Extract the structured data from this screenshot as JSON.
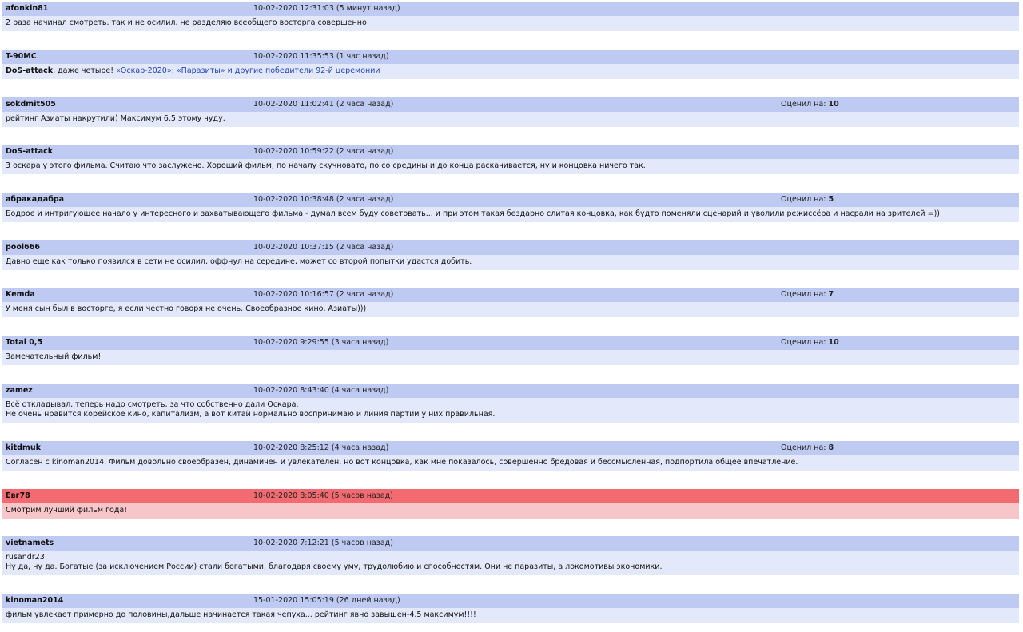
{
  "rating_label": "Оценил на:",
  "comments": [
    {
      "user": "afonkin81",
      "time": "10-02-2020 12:31:03 (5 минут назад)",
      "rating": "",
      "lines": [
        "2 раза начинал смотреть. так и не осилил. не разделяю всеобщего восторга совершенно"
      ]
    },
    {
      "user": "T-90MC",
      "time": "10-02-2020 11:35:53 (1 час назад)",
      "rating": "",
      "reply_to": "DoS-attack",
      "reply_text": ", даже четыре! ",
      "link": "«Оскар-2020»: «Паразиты» и другие победители 92-й церемонии"
    },
    {
      "user": "sokdmit505",
      "time": "10-02-2020 11:02:41 (2 часа назад)",
      "rating": "10",
      "lines": [
        "рейтинг Азиаты накрутили) Максимум 6.5 этому чуду."
      ]
    },
    {
      "user": "DoS-attack",
      "time": "10-02-2020 10:59:22 (2 часа назад)",
      "rating": "",
      "lines": [
        "3 оскара у этого фильма. Считаю что заслужено. Хороший фильм, по началу скучновато, по со средины и до конца раскачивается, ну и концовка ничего так."
      ]
    },
    {
      "user": "абракадабра",
      "time": "10-02-2020 10:38:48 (2 часа назад)",
      "rating": "5",
      "lines": [
        "Бодрое и интригующее начало у интересного и захватывающего фильма - думал всем буду советовать... и при этом такая бездарно слитая концовка, как будто поменяли сценарий и уволили режиссёра и насрали на зрителей =))"
      ]
    },
    {
      "user": "pool666",
      "time": "10-02-2020 10:37:15 (2 часа назад)",
      "rating": "",
      "lines": [
        "Давно еще как только появился в сети не осилил, оффнул на середине, может со второй попытки удастся добить."
      ]
    },
    {
      "user": "Kemda",
      "time": "10-02-2020 10:16:57 (2 часа назад)",
      "rating": "7",
      "lines": [
        "У меня сын был в восторге, я если честно говоря не очень. Своеобразное кино. Азиаты)))"
      ]
    },
    {
      "user": "Total 0,5",
      "time": "10-02-2020 9:29:55 (3 часа назад)",
      "rating": "10",
      "lines": [
        "Замечательный фильм!"
      ]
    },
    {
      "user": "zamez",
      "time": "10-02-2020 8:43:40 (4 часа назад)",
      "rating": "",
      "lines": [
        "Всё откладывал, теперь надо смотреть, за что собственно дали Оскара.",
        "Не очень нравится корейское кино, капитализм, а вот китай нормально воспринимаю и линия партии у них правильная."
      ]
    },
    {
      "user": "kitdmuk",
      "time": "10-02-2020 8:25:12 (4 часа назад)",
      "rating": "8",
      "lines": [
        "Согласен с kinoman2014. Фильм довольно своеобразен, динамичен и увлекателен, но вот концовка, как мне показалось, совершенно бредовая и бессмысленная, подпортила общее впечатление."
      ]
    },
    {
      "user": "Евг78",
      "time": "10-02-2020 8:05:40 (5 часов назад)",
      "rating": "",
      "highlight": true,
      "lines": [
        "Смотрим лучший фильм года!"
      ]
    },
    {
      "user": "vietnamets",
      "time": "10-02-2020 7:12:21 (5 часов назад)",
      "rating": "",
      "lines": [
        "rusandr23",
        "Ну да, ну да. Богатые (за исключением России) стали богатыми, благодаря своему уму, трудолюбию и способностям. Они не паразиты, а локомотивы экономики."
      ]
    },
    {
      "user": "kinoman2014",
      "time": "15-01-2020 15:05:19 (26 дней назад)",
      "rating": "",
      "lines": [
        "фильм увлекает примерно до половины,дальше начинается такая чепуха... рейтинг явно завышен-4.5 максимум!!!!"
      ]
    }
  ]
}
